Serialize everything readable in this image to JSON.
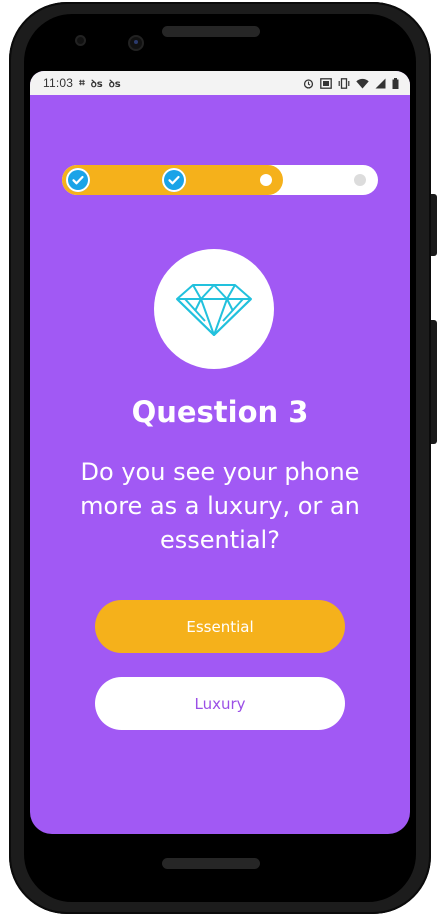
{
  "status_bar": {
    "time": "11:03",
    "left_icons": [
      "notification-icon",
      "app-icon",
      "app-icon"
    ],
    "right_icons": [
      "alarm-icon",
      "cast-icon",
      "vibrate-icon",
      "wifi-icon",
      "signal-icon",
      "battery-icon"
    ]
  },
  "progress": {
    "steps": 4,
    "completed": 2,
    "current_step": 3,
    "fill_fraction": 0.7
  },
  "question": {
    "icon": "diamond-icon",
    "title": "Question 3",
    "text": "Do you see your phone more as a luxury, or an essential?"
  },
  "answers": {
    "primary_label": "Essential",
    "secondary_label": "Luxury"
  },
  "colors": {
    "background": "#a159f4",
    "accent": "#f5b11b",
    "check": "#1aa3e8",
    "diamond": "#22c1dd"
  }
}
